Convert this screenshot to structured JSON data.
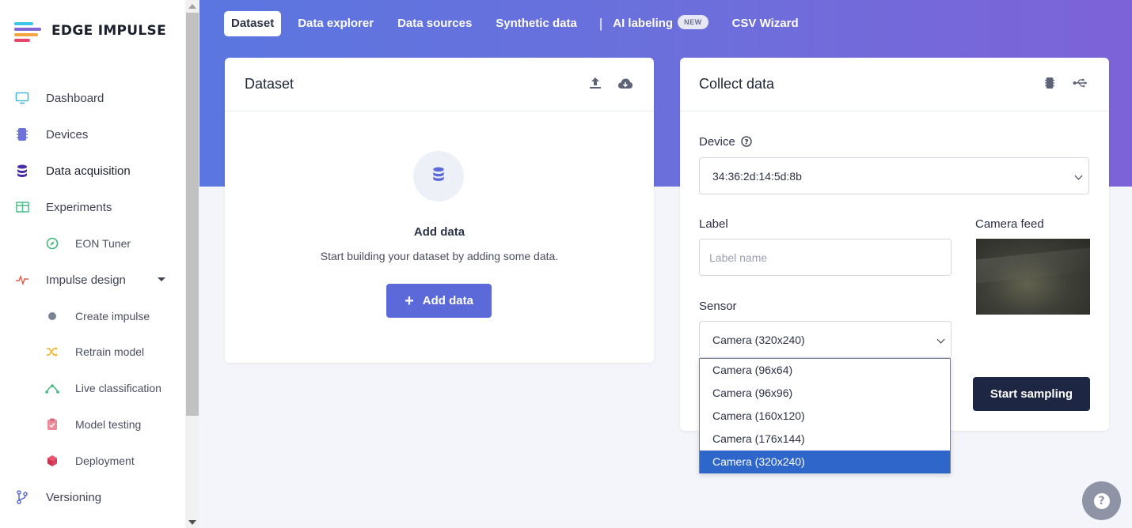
{
  "brand": {
    "name": "EDGE IMPULSE"
  },
  "sidebar": {
    "items": [
      {
        "label": "Dashboard",
        "icon": "monitor-icon"
      },
      {
        "label": "Devices",
        "icon": "chip-icon"
      },
      {
        "label": "Data acquisition",
        "icon": "database-icon",
        "active": true
      },
      {
        "label": "Experiments",
        "icon": "table-icon"
      },
      {
        "label": "EON Tuner",
        "icon": "compass-icon"
      },
      {
        "label": "Impulse design",
        "icon": "pulse-icon"
      },
      {
        "label": "Create impulse",
        "icon": "dot-icon"
      },
      {
        "label": "Retrain model",
        "icon": "shuffle-icon"
      },
      {
        "label": "Live classification",
        "icon": "curve-icon"
      },
      {
        "label": "Model testing",
        "icon": "clipboard-icon"
      },
      {
        "label": "Deployment",
        "icon": "cube-icon"
      },
      {
        "label": "Versioning",
        "icon": "branch-icon"
      }
    ]
  },
  "tabs": {
    "dataset": "Dataset",
    "data_explorer": "Data explorer",
    "data_sources": "Data sources",
    "synthetic_data": "Synthetic data",
    "separator": "|",
    "ai_labeling": "AI labeling",
    "ai_labeling_badge": "NEW",
    "csv_wizard": "CSV Wizard"
  },
  "dataset_card": {
    "title": "Dataset",
    "empty_title": "Add data",
    "empty_subtitle": "Start building your dataset by adding some data.",
    "add_button": "Add data",
    "plus": "+"
  },
  "collect_card": {
    "title": "Collect data",
    "device_label": "Device",
    "device_value": "34:36:2d:14:5d:8b",
    "label_label": "Label",
    "label_placeholder": "Label name",
    "camera_feed_label": "Camera feed",
    "sensor_label": "Sensor",
    "sensor_value": "Camera (320x240)",
    "start_button": "Start sampling"
  },
  "sensor_options": [
    "Camera (96x64)",
    "Camera (96x96)",
    "Camera (160x120)",
    "Camera (176x144)",
    "Camera (320x240)"
  ],
  "help": {
    "symbol": "?"
  },
  "colors": {
    "accent": "#5b6ad8",
    "dark_button": "#1d2642",
    "dropdown_selected": "#2f66c9"
  }
}
